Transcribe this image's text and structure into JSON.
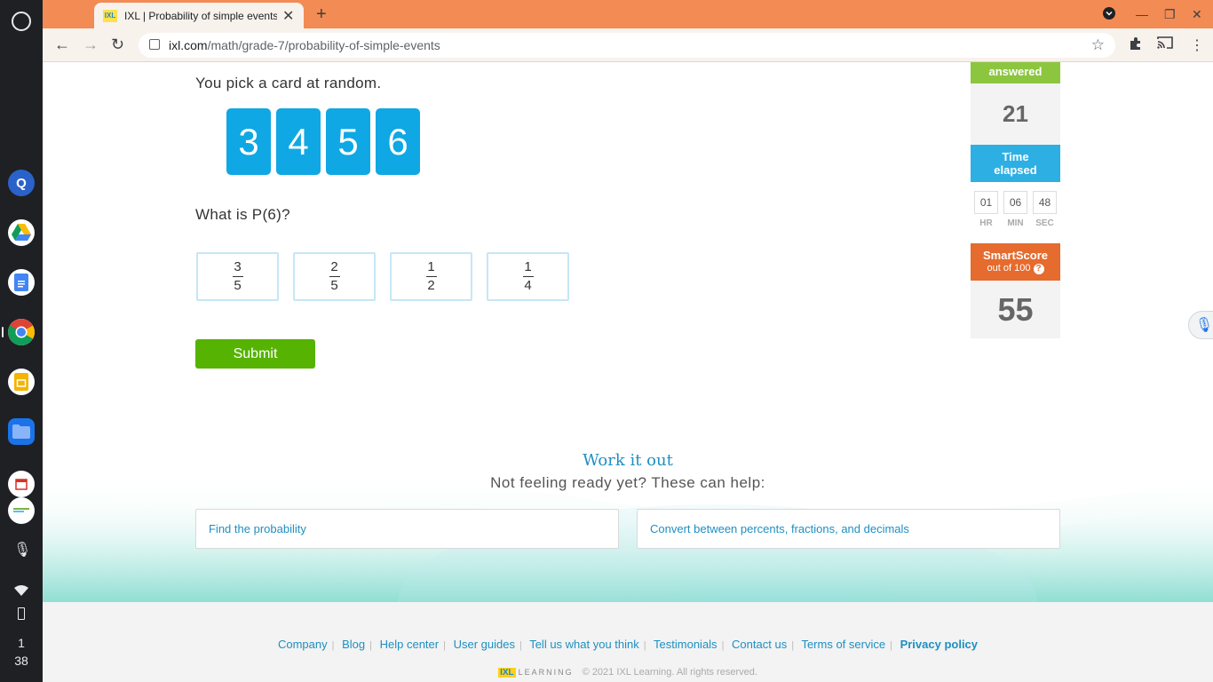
{
  "browser": {
    "tab_title": "IXL | Probability of simple events",
    "favicon_text": "IXL",
    "url_host": "ixl.com",
    "url_path": "/math/grade-7/probability-of-simple-events"
  },
  "shelf": {
    "clock_hour": "1",
    "clock_minute": "38"
  },
  "problem": {
    "prompt": "You pick a card at random.",
    "cards": [
      "3",
      "4",
      "5",
      "6"
    ],
    "question": "What is P(6)?",
    "choices": [
      {
        "num": "3",
        "den": "5"
      },
      {
        "num": "2",
        "den": "5"
      },
      {
        "num": "1",
        "den": "2"
      },
      {
        "num": "1",
        "den": "4"
      }
    ],
    "submit_label": "Submit"
  },
  "stats": {
    "answered_label": "answered",
    "answered_value": "21",
    "time_label_1": "Time",
    "time_label_2": "elapsed",
    "hr": "01",
    "min": "06",
    "sec": "48",
    "hr_label": "HR",
    "min_label": "MIN",
    "sec_label": "SEC",
    "smartscore_label": "SmartScore",
    "smartscore_sub": "out of 100",
    "smartscore_help": "?",
    "smartscore_value": "55"
  },
  "work_it_out": {
    "title": "Work it out",
    "subtitle": "Not feeling ready yet? These can help:",
    "links": [
      "Find the probability",
      "Convert between percents, fractions, and decimals"
    ]
  },
  "footer": {
    "links": [
      "Company",
      "Blog",
      "Help center",
      "User guides",
      "Tell us what you think",
      "Testimonials",
      "Contact us",
      "Terms of service",
      "Privacy policy"
    ],
    "logo_text": "IXL",
    "logo_word": "LEARNING",
    "copyright": "© 2021 IXL Learning. All rights reserved."
  },
  "colors": {
    "titlebar": "#f28b54",
    "card_blue": "#0fa8e4",
    "submit_green": "#56b302",
    "stat_green": "#8cc63f",
    "stat_blue": "#2dafe3",
    "stat_orange": "#e56b2e",
    "link_blue": "#1e8fc2"
  }
}
